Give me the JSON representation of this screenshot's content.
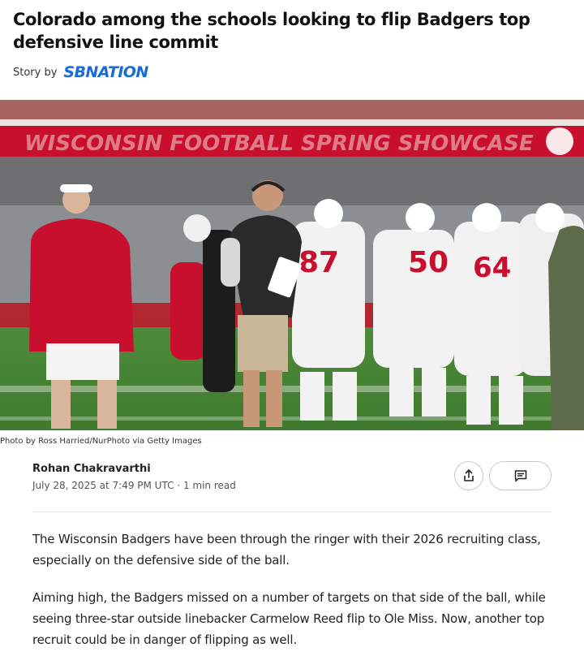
{
  "article": {
    "headline": "Colorado among the schools looking to flip Badgers top defensive line commit",
    "story_by_label": "Story by",
    "publisher_logo_text": "SBNATION",
    "photo": {
      "banner_text": "WISCONSIN FOOTBALL SPRING SHOWCASE",
      "caption": "Photo by Ross Harried/NurPhoto via Getty Images",
      "jersey_numbers": [
        "87",
        "50",
        "64"
      ]
    },
    "author": "Rohan Chakravarthi",
    "published": "July 28, 2025 at 7:49 PM UTC",
    "read_time": "1 min read",
    "paragraphs": [
      "The Wisconsin Badgers have been through the ringer with their 2026 recruiting class, especially on the defensive side of the ball.",
      "Aiming high, the Badgers missed on a number of targets on that side of the ball, while seeing three-star outside linebacker Carmelow Reed flip to Ole Miss. Now, another top recruit could be in danger of flipping as well."
    ]
  },
  "actions": {
    "share_icon": "share-icon",
    "comment_icon": "comment-icon"
  },
  "colors": {
    "brand": "#1a6bd8",
    "team_red": "#c8102e"
  }
}
